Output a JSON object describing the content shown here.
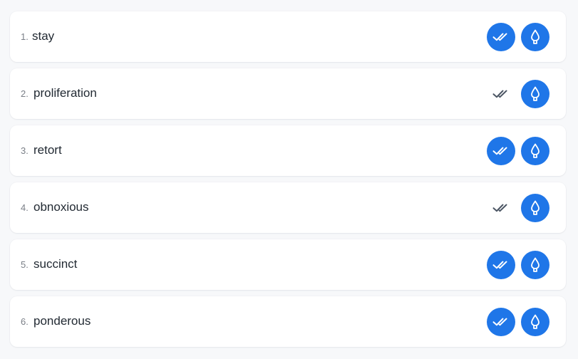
{
  "accent_color": "#1f76e8",
  "items": [
    {
      "number": "1.",
      "word": "stay",
      "checked": true
    },
    {
      "number": "2.",
      "word": "proliferation",
      "checked": false
    },
    {
      "number": "3.",
      "word": "retort",
      "checked": true
    },
    {
      "number": "4.",
      "word": "obnoxious",
      "checked": false
    },
    {
      "number": "5.",
      "word": "succinct",
      "checked": true
    },
    {
      "number": "6.",
      "word": "ponderous",
      "checked": true
    }
  ],
  "icons": {
    "check": "double-check-icon",
    "drop": "ink-drop-icon"
  }
}
